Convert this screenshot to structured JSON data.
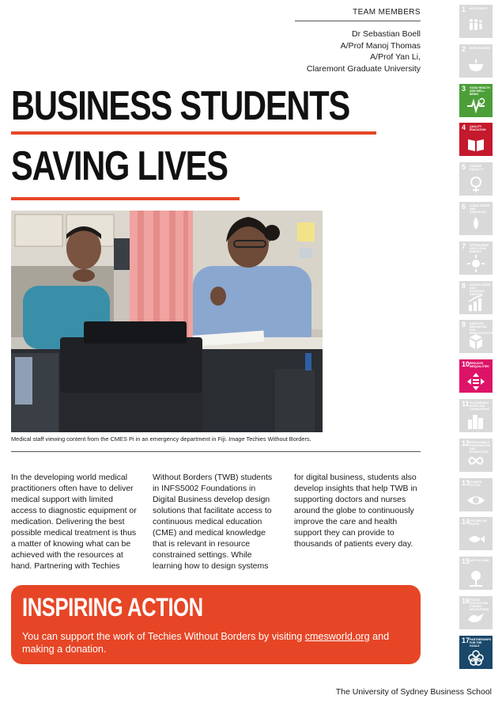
{
  "team": {
    "heading": "TEAM MEMBERS",
    "members": [
      "Dr Sebastian Boell",
      "A/Prof Manoj Thomas",
      "A/Prof Yan Li,",
      "Claremont Graduate University"
    ]
  },
  "title": {
    "line1": "BUSINESS STUDENTS",
    "line2": "SAVING LIVES"
  },
  "caption": {
    "text": "Medical staff viewing content from the CMES Pi in an emergency department in Fiji. ",
    "image_label": "Image",
    "credit": " Techies Without Borders."
  },
  "body": {
    "col1": "In the developing world medical practitioners often have to deliver medical support with limited access to diagnostic equipment or medication. Delivering the best possible medical treatment is thus a matter of knowing what can be achieved with the resources at hand. Partnering with Techies",
    "col2": "Without Borders (TWB) students in INFS5002 Foundations in Digital Business develop design solutions that facilitate access to continuous medical education (CME) and medical knowledge that is relevant in resource constrained settings. While learning how to design systems",
    "col3": "for digital business, students also develop insights that help TWB in supporting doctors and nurses around the globe to continuously improve the care and health support they can provide to thousands of patients every day."
  },
  "cta": {
    "heading": "INSPIRING ACTION",
    "text_before": "You can support the work of Techies Without Borders by visiting ",
    "link": "cmesworld.org",
    "text_after": " and making a donation."
  },
  "sdg": {
    "inactive_color": "#d9d9d9",
    "tiles": [
      {
        "num": "1",
        "label": "No poverty",
        "icon": "family-icon",
        "active": false
      },
      {
        "num": "2",
        "label": "Zero hunger",
        "icon": "bowl-icon",
        "active": false
      },
      {
        "num": "3",
        "label": "Good health and well-being",
        "icon": "heartbeat-icon",
        "active": true,
        "color": "#4c9f38"
      },
      {
        "num": "4",
        "label": "Quality education",
        "icon": "book-icon",
        "active": true,
        "color": "#c5192d"
      },
      {
        "num": "5",
        "label": "Gender equality",
        "icon": "gender-icon",
        "active": false
      },
      {
        "num": "6",
        "label": "Clean water and sanitation",
        "icon": "water-icon",
        "active": false
      },
      {
        "num": "7",
        "label": "Affordable and clean energy",
        "icon": "sun-icon",
        "active": false
      },
      {
        "num": "8",
        "label": "Decent work and economic growth",
        "icon": "growth-chart-icon",
        "active": false
      },
      {
        "num": "9",
        "label": "Industry, innovation and infrastructure",
        "icon": "cubes-icon",
        "active": false
      },
      {
        "num": "10",
        "label": "Reduced inequalities",
        "icon": "equality-arrows-icon",
        "active": true,
        "color": "#dd1367"
      },
      {
        "num": "11",
        "label": "Sustainable cities and communities",
        "icon": "city-icon",
        "active": false
      },
      {
        "num": "12",
        "label": "Responsible consumption and production",
        "icon": "infinity-icon",
        "active": false
      },
      {
        "num": "13",
        "label": "Climate action",
        "icon": "eye-globe-icon",
        "active": false
      },
      {
        "num": "14",
        "label": "Life below water",
        "icon": "fish-icon",
        "active": false
      },
      {
        "num": "15",
        "label": "Life on land",
        "icon": "tree-icon",
        "active": false
      },
      {
        "num": "16",
        "label": "Peace, justice and strong institutions",
        "icon": "dove-icon",
        "active": false
      },
      {
        "num": "17",
        "label": "Partnerships for the goals",
        "icon": "rings-icon",
        "active": true,
        "color": "#19486a"
      }
    ]
  },
  "footer": {
    "text": "The University of Sydney Business School"
  }
}
